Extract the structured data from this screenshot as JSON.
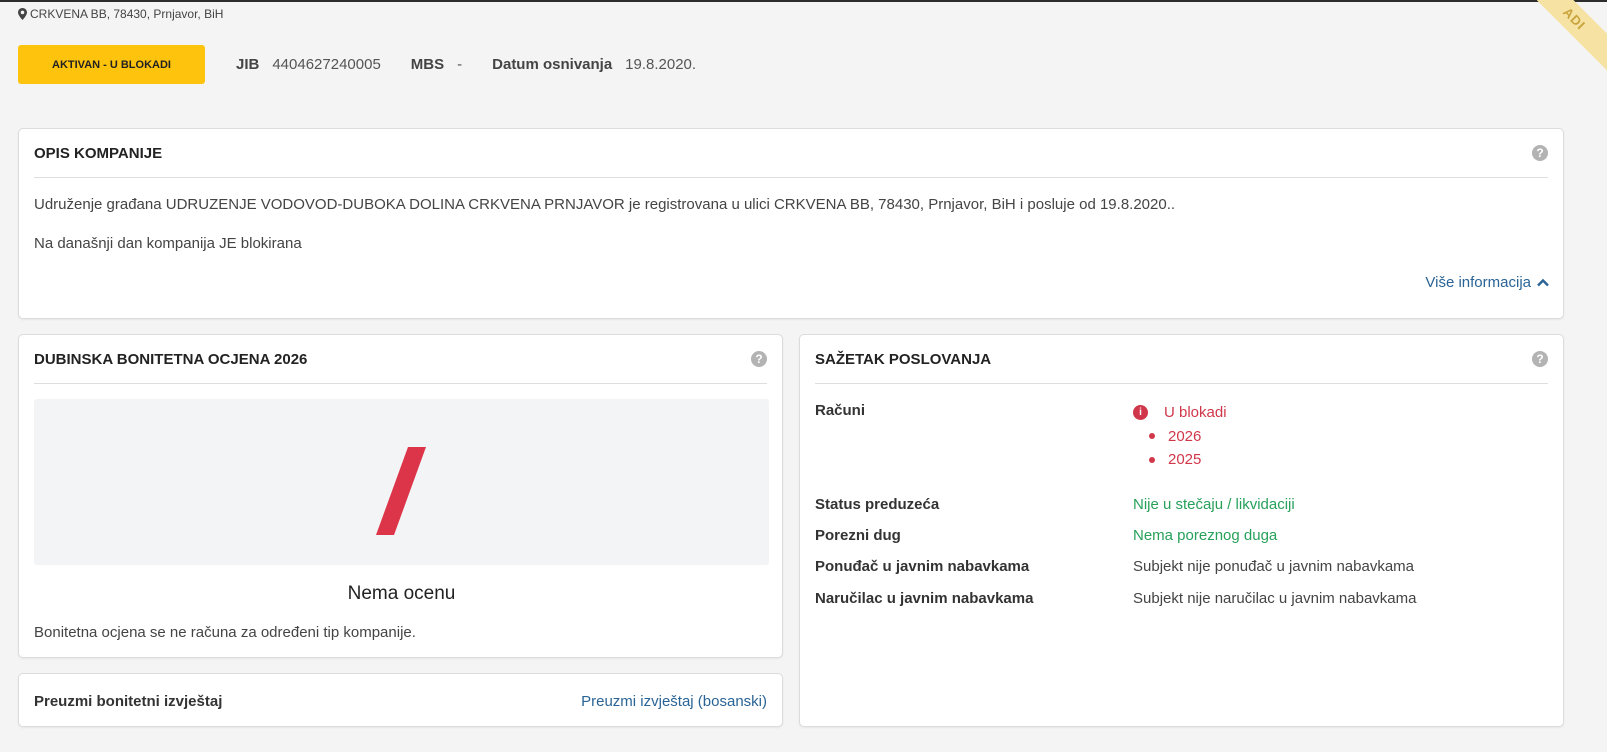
{
  "header": {
    "address": "CRKVENA BB, 78430, Prnjavor, BiH",
    "status_label": "AKTIVAN - U BLOKADI",
    "ribbon_text": "ADI",
    "meta": [
      {
        "key": "JIB",
        "value": "4404627240005"
      },
      {
        "key": "MBS",
        "value": "-"
      },
      {
        "key": "Datum osnivanja",
        "value": "19.8.2020."
      }
    ]
  },
  "description": {
    "title": "OPIS KOMPANIJE",
    "paragraph1": "Udruženje građana UDRUZENJE VODOVOD-DUBOKA DOLINA CRKVENA PRNJAVOR je registrovana u ulici CRKVENA BB, 78430, Prnjavor, BiH i posluje od 19.8.2020..",
    "paragraph2": "Na današnji dan kompanija JE blokirana",
    "more_link": "Više informacija"
  },
  "rating": {
    "title": "DUBINSKA BONITETNA OCJENA 2026",
    "grade_label": "Nema ocenu",
    "note": "Bonitetna ocjena se ne računa za određeni tip kompanije.",
    "slash_color": "#dc3448"
  },
  "download": {
    "title": "Preuzmi bonitetni izvještaj",
    "link": "Preuzmi izvještaj (bosanski)"
  },
  "summary": {
    "title": "SAŽETAK POSLOVANJA",
    "accounts_label": "Računi",
    "accounts_status": "U blokadi",
    "accounts_years": [
      "2026",
      "2025"
    ],
    "rows": [
      {
        "label": "Status preduzeća",
        "value": "Nije u stečaju / likvidaciji"
      },
      {
        "label": "Porezni dug",
        "value": "Nema poreznog duga"
      },
      {
        "label": "Ponuđač u javnim nabavkama",
        "value": "Subjekt nije ponuđač u javnim nabavkama"
      },
      {
        "label": "Naručilac u javnim nabavkama",
        "value": "Subjekt nije naručilac u javnim nabavkama"
      }
    ]
  },
  "colors": {
    "accent_yellow": "#fec30d",
    "link_blue": "#2a6496",
    "danger_red": "#d0374a",
    "success_green": "#28a05a"
  },
  "icons": {
    "address": "map-pin-icon",
    "help": "question-circle-icon",
    "more": "chevron-up-icon",
    "accounts": "info-circle-icon"
  }
}
